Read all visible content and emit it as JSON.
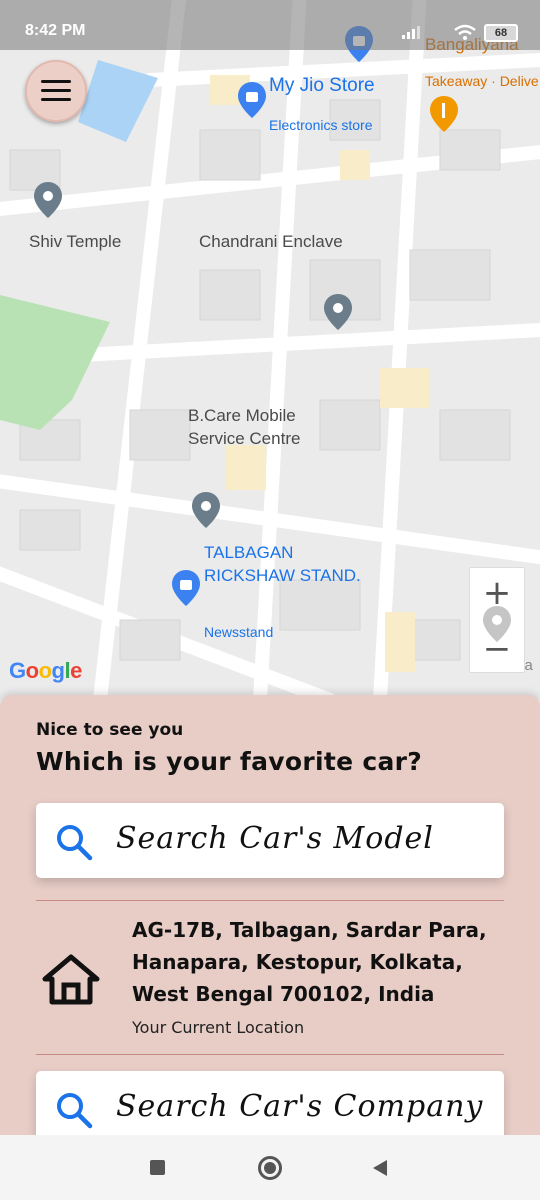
{
  "status": {
    "time": "8:42 PM",
    "battery": "68"
  },
  "map": {
    "labels": {
      "bangaliyana": "Bangaliyana",
      "jio_store": "My Jio Store",
      "electronics": "Electronics store",
      "takeaway": "Takeaway · Delive",
      "shiv_temple": "Shiv Temple",
      "chandrani": "Chandrani Enclave",
      "bcare_line1": "B.Care Mobile",
      "bcare_line2": "Service Centre",
      "talbagan_line1": "TALBAGAN",
      "talbagan_line2": "RICKSHAW STAND.",
      "newsstand": "Newsstand",
      "krishna": "Krishna"
    },
    "attribution": "Google",
    "zoom_in": "+",
    "zoom_out": "−"
  },
  "sheet": {
    "greeting": "Nice to see you",
    "question": "Which is your favorite car?",
    "search_model": {
      "placeholder": "Search Car's Model"
    },
    "location": {
      "address": "AG-17B, Talbagan, Sardar Para, Hanapara, Kestopur, Kolkata, West Bengal 700102, India",
      "caption": "Your Current Location"
    },
    "search_company": {
      "placeholder": "Search Car's Company"
    }
  },
  "colors": {
    "sheet_bg": "#e8cdc6",
    "accent_blue": "#1a73e8",
    "divider": "#c58a86"
  }
}
